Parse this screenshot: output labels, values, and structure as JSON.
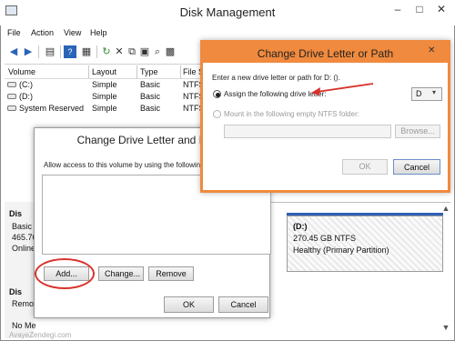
{
  "window": {
    "title": "Disk Management",
    "minimize": "–",
    "maximize": "□",
    "close": "✕"
  },
  "menu": [
    "File",
    "Action",
    "View",
    "Help"
  ],
  "toolbar_icons": [
    "back-icon",
    "forward-icon",
    "list-view-icon",
    "help-icon",
    "properties-icon",
    "refresh-icon",
    "delete-icon",
    "copy-icon",
    "paste-icon",
    "search-icon",
    "settings-icon"
  ],
  "volume_table": {
    "headers": [
      "Volume",
      "Layout",
      "Type",
      "File S"
    ],
    "rows": [
      {
        "volume": "(C:)",
        "layout": "Simple",
        "type": "Basic",
        "fs": "NTFS"
      },
      {
        "volume": "(D:)",
        "layout": "Simple",
        "type": "Basic",
        "fs": "NTFS"
      },
      {
        "volume": "System Reserved",
        "layout": "Simple",
        "type": "Basic",
        "fs": "NTFS"
      }
    ]
  },
  "disk_pane": {
    "disk0": {
      "name": "Dis",
      "type": "Basic",
      "size": "465.76",
      "status": "Online"
    },
    "disk1": {
      "name": "Dis",
      "type": "Remo",
      "status": "No Me"
    },
    "partition": {
      "label": "(D:)",
      "size": "270.45 GB NTFS",
      "status": "Healthy (Primary Partition)"
    }
  },
  "dialog_paths": {
    "title": "Change Drive Letter and Paths",
    "prompt": "Allow access to this volume by using the following dr",
    "add_label": "Add...",
    "change_label": "Change...",
    "remove_label": "Remove",
    "ok_label": "OK",
    "cancel_label": "Cancel"
  },
  "dialog_letter": {
    "title": "Change Drive Letter or Path",
    "prompt": "Enter a new drive letter or path for D: ().",
    "assign_label": "Assign the following drive letter:",
    "mount_label": "Mount in the following empty NTFS folder:",
    "drive_letter": "D",
    "browse_label": "Browse...",
    "ok_label": "OK",
    "cancel_label": "Cancel"
  },
  "watermark": "AvayeZendegi.com",
  "colors": {
    "accent_orange": "#f08a3e",
    "highlight_red": "#d9312a",
    "partition_blue": "#2f5fb6"
  }
}
